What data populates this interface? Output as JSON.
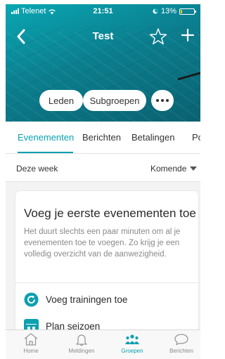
{
  "status_bar": {
    "carrier": "Telenet",
    "time": "21:51",
    "battery": "13%",
    "battery_level": 0.13
  },
  "nav": {
    "title": "Test",
    "back_icon": "chevron-left-icon",
    "star_icon": "star-icon",
    "add_icon": "plus-icon"
  },
  "header_buttons": {
    "members": "Leden",
    "subgroups": "Subgroepen",
    "more_icon": "ellipsis-icon"
  },
  "tabs": [
    {
      "label": "Evenementen",
      "active": true
    },
    {
      "label": "Berichten",
      "active": false
    },
    {
      "label": "Betalingen",
      "active": false
    },
    {
      "label": "Pol",
      "active": false
    }
  ],
  "filter": {
    "left": "Deze week",
    "right": "Komende"
  },
  "card": {
    "title": "Voeg je eerste evenementen toe",
    "body": "Het duurt slechts een paar minuten om al je evenementen toe te voegen. Zo krijg je een volledig overzicht van de aanwezigheid.",
    "actions": [
      {
        "label": "Voeg trainingen toe",
        "icon": "refresh-circle-icon"
      },
      {
        "label": "Plan seizoen",
        "icon": "calendar-icon"
      }
    ]
  },
  "tab_bar": [
    {
      "label": "Home",
      "icon": "home-icon",
      "active": false
    },
    {
      "label": "Meldingen",
      "icon": "bell-icon",
      "active": false
    },
    {
      "label": "Groepen",
      "icon": "groups-icon",
      "active": true
    },
    {
      "label": "Berichten",
      "icon": "chat-bubble-icon",
      "active": false
    }
  ],
  "colors": {
    "accent": "#0aa0b0",
    "header_dark": "#0a6170",
    "header_light": "#0aa7b3"
  }
}
